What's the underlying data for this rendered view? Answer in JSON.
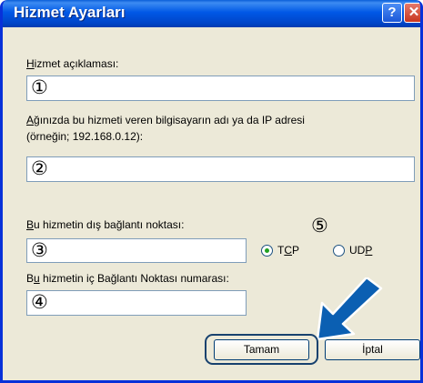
{
  "window": {
    "title": "Hizmet Ayarları",
    "help_glyph": "?",
    "close_glyph": "✕"
  },
  "fields": {
    "service_description": {
      "accel": "H",
      "rest": "izmet açıklaması:",
      "marker": "①"
    },
    "host": {
      "accel": "A",
      "rest_line1": "ğınızda bu hizmeti veren bilgisayarın adı ya da IP adresi",
      "line2": "(örneğin;  192.168.0.12):",
      "marker": "②"
    },
    "external_port": {
      "accel": "B",
      "rest": "u hizmetin dış bağlantı noktası:",
      "marker": "③"
    },
    "internal_port": {
      "pre": "B",
      "accel": "u",
      "rest": " hizmetin iç Bağlantı Noktası numarası:",
      "marker": "④"
    }
  },
  "protocol": {
    "marker": "⑤",
    "tcp": {
      "pre": "T",
      "accel": "C",
      "post": "P",
      "selected": true
    },
    "udp": {
      "pre": "UD",
      "accel": "P",
      "post": "",
      "selected": false
    }
  },
  "buttons": {
    "ok": "Tamam",
    "cancel": "İptal"
  },
  "colors": {
    "title_bar": "#0058e6",
    "dialog_bg": "#ece9d8",
    "arrow": "#0b5fb2",
    "field_border": "#7f9db9"
  }
}
